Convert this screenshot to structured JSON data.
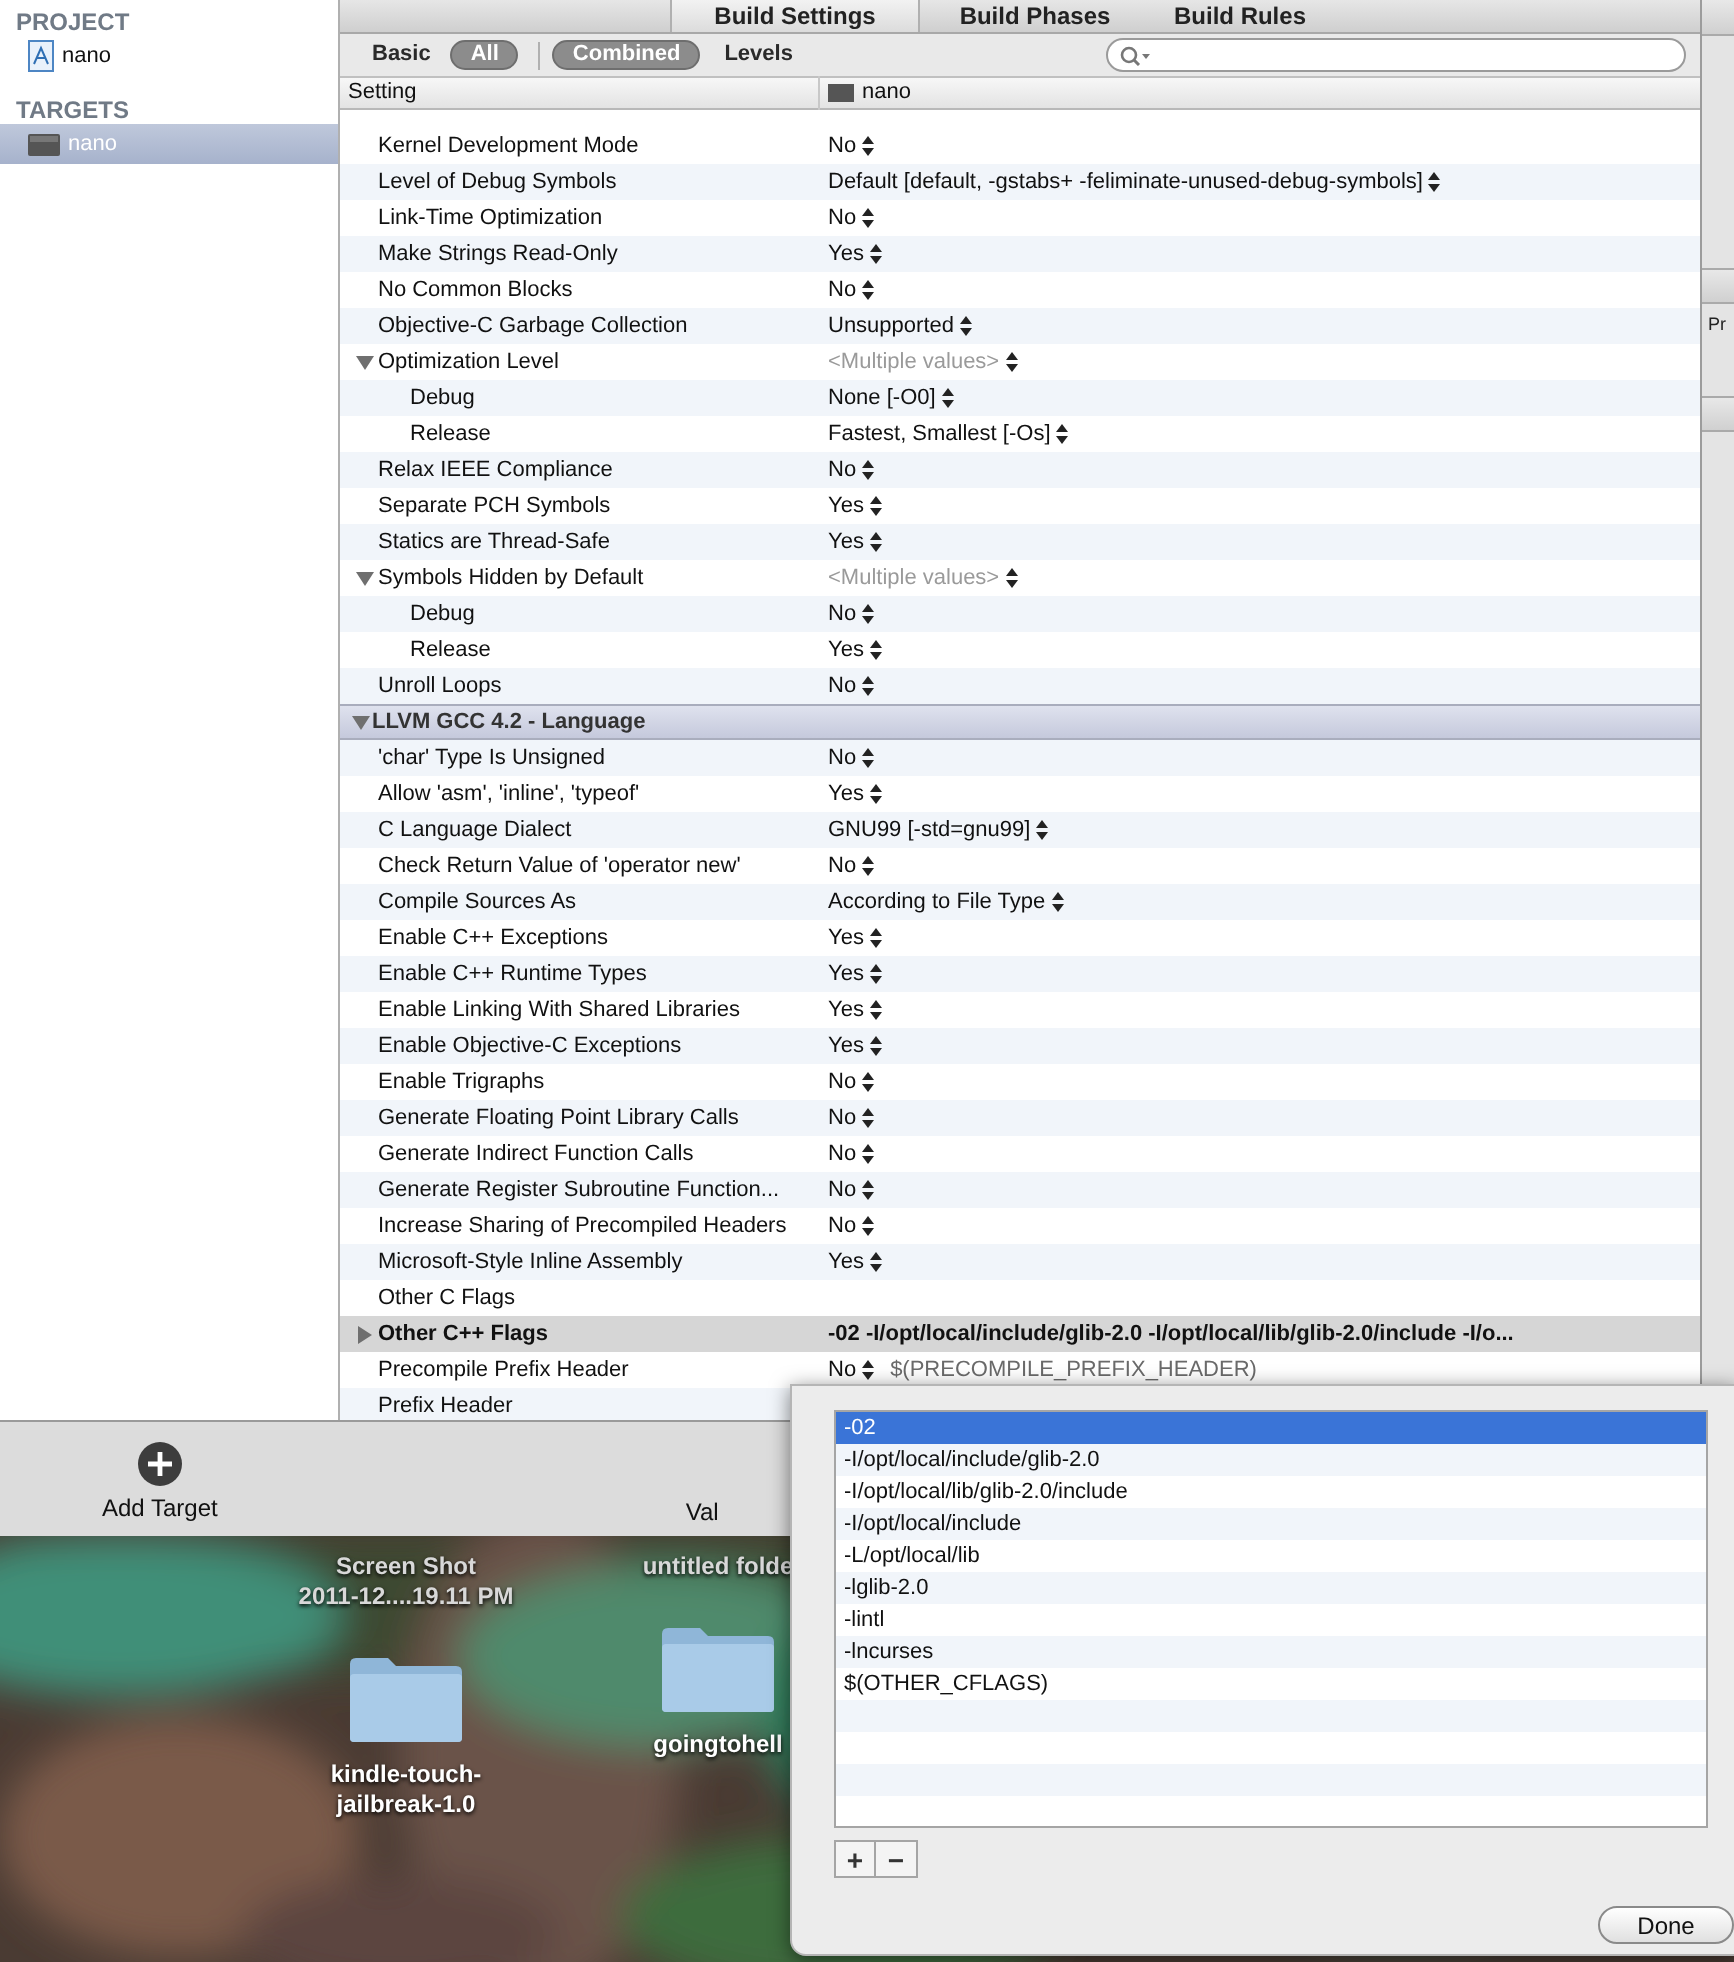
{
  "sidebar": {
    "sections": [
      {
        "title": "PROJECT",
        "items": [
          {
            "label": "nano",
            "kind": "project",
            "selected": false
          }
        ]
      },
      {
        "title": "TARGETS",
        "items": [
          {
            "label": "nano",
            "kind": "target",
            "selected": true
          }
        ]
      }
    ]
  },
  "tabs": [
    {
      "label": "Build Settings",
      "selected": true
    },
    {
      "label": "Build Phases",
      "selected": false
    },
    {
      "label": "Build Rules",
      "selected": false
    }
  ],
  "filters": {
    "scope": [
      {
        "label": "Basic",
        "selected": false
      },
      {
        "label": "All",
        "selected": true
      }
    ],
    "view": [
      {
        "label": "Combined",
        "selected": true
      },
      {
        "label": "Levels",
        "selected": false
      }
    ]
  },
  "table": {
    "columns": [
      "Setting",
      "nano"
    ],
    "sections": [
      {
        "rows": [
          {
            "name": "Kernel Development Mode",
            "value": "No",
            "popup": true,
            "selected": false,
            "customized": false
          },
          {
            "name": "Level of Debug Symbols",
            "value": "Default [default, -gstabs+ -feliminate-unused-debug-symbols]",
            "popup": true,
            "selected": false,
            "customized": false
          },
          {
            "name": "Link-Time Optimization",
            "value": "No",
            "popup": true,
            "selected": false,
            "customized": false
          },
          {
            "name": "Make Strings Read-Only",
            "value": "Yes",
            "popup": true,
            "selected": false,
            "customized": false
          },
          {
            "name": "No Common Blocks",
            "value": "No",
            "popup": true,
            "selected": false,
            "customized": false
          },
          {
            "name": "Objective-C Garbage Collection",
            "value": "Unsupported",
            "popup": true,
            "selected": false,
            "customized": false
          },
          {
            "name": "Optimization Level",
            "value": "<Multiple values>",
            "popup": true,
            "selected": false,
            "customized": false,
            "expanded": true,
            "children": [
              {
                "name": "Debug",
                "value": "None [-O0]",
                "popup": true,
                "selected": false,
                "customized": false
              },
              {
                "name": "Release",
                "value": "Fastest, Smallest [-Os]",
                "popup": true,
                "selected": false,
                "customized": false
              }
            ]
          },
          {
            "name": "Relax IEEE Compliance",
            "value": "No",
            "popup": true,
            "selected": false,
            "customized": false
          },
          {
            "name": "Separate PCH Symbols",
            "value": "Yes",
            "popup": true,
            "selected": false,
            "customized": false
          },
          {
            "name": "Statics are Thread-Safe",
            "value": "Yes",
            "popup": true,
            "selected": false,
            "customized": false
          },
          {
            "name": "Symbols Hidden by Default",
            "value": "<Multiple values>",
            "popup": true,
            "selected": false,
            "customized": false,
            "expanded": true,
            "children": [
              {
                "name": "Debug",
                "value": "No",
                "popup": true,
                "selected": false,
                "customized": false
              },
              {
                "name": "Release",
                "value": "Yes",
                "popup": true,
                "selected": false,
                "customized": false
              }
            ]
          },
          {
            "name": "Unroll Loops",
            "value": "No",
            "popup": true,
            "selected": false,
            "customized": false
          }
        ]
      },
      {
        "title": "LLVM GCC 4.2 - Language",
        "expanded": true,
        "rows": [
          {
            "name": "'char' Type Is Unsigned",
            "value": "No",
            "popup": true,
            "selected": false,
            "customized": false
          },
          {
            "name": "Allow 'asm', 'inline', 'typeof'",
            "value": "Yes",
            "popup": true,
            "selected": false,
            "customized": false
          },
          {
            "name": "C Language Dialect",
            "value": "GNU99 [-std=gnu99]",
            "popup": true,
            "selected": false,
            "customized": false
          },
          {
            "name": "Check Return Value of 'operator new'",
            "value": "No",
            "popup": true,
            "selected": false,
            "customized": false
          },
          {
            "name": "Compile Sources As",
            "value": "According to File Type",
            "popup": true,
            "selected": false,
            "customized": false
          },
          {
            "name": "Enable C++ Exceptions",
            "value": "Yes",
            "popup": true,
            "selected": false,
            "customized": false
          },
          {
            "name": "Enable C++ Runtime Types",
            "value": "Yes",
            "popup": true,
            "selected": false,
            "customized": false
          },
          {
            "name": "Enable Linking With Shared Libraries",
            "value": "Yes",
            "popup": true,
            "selected": false,
            "customized": false
          },
          {
            "name": "Enable Objective-C Exceptions",
            "value": "Yes",
            "popup": true,
            "selected": false,
            "customized": false
          },
          {
            "name": "Enable Trigraphs",
            "value": "No",
            "popup": true,
            "selected": false,
            "customized": false
          },
          {
            "name": "Generate Floating Point Library Calls",
            "value": "No",
            "popup": true,
            "selected": false,
            "customized": false
          },
          {
            "name": "Generate Indirect Function Calls",
            "value": "No",
            "popup": true,
            "selected": false,
            "customized": false
          },
          {
            "name": "Generate Register Subroutine Function...",
            "value": "No",
            "popup": true,
            "selected": false,
            "customized": false
          },
          {
            "name": "Increase Sharing of Precompiled Headers",
            "value": "No",
            "popup": true,
            "selected": false,
            "customized": false
          },
          {
            "name": "Microsoft-Style Inline Assembly",
            "value": "Yes",
            "popup": true,
            "selected": false,
            "customized": false
          },
          {
            "name": "Other C Flags",
            "popup": false,
            "selected": false,
            "customized": false
          },
          {
            "name": "Other C++ Flags",
            "value": "-02 -I/opt/local/include/glib-2.0 -I/opt/local/lib/glib-2.0/include -I/o...",
            "popup": false,
            "selected": true,
            "customized": true,
            "expanded": false
          },
          {
            "name": "Precompile Prefix Header",
            "value": "No",
            "note": "$(PRECOMPILE_PREFIX_HEADER)",
            "popup": true,
            "selected": false,
            "customized": false
          },
          {
            "name": "Prefix Header",
            "popup": false,
            "selected": false,
            "customized": false
          }
        ]
      }
    ]
  },
  "inspector": {
    "label": "Pr"
  },
  "bottom_bar": {
    "add_label": "Add Target",
    "cut_label": "Val"
  },
  "desktop": {
    "items": [
      {
        "kind": "caption",
        "lines": [
          "Screen Shot",
          "2011-12....19.11 PM"
        ]
      },
      {
        "kind": "folder",
        "lines": [
          "kindle-touch-",
          "jailbreak-1.0"
        ]
      },
      {
        "kind": "caption",
        "lines": [
          "untitled folde"
        ]
      },
      {
        "kind": "folder",
        "lines": [
          "goingtohell"
        ]
      }
    ]
  },
  "popover": {
    "items": [
      {
        "label": "-02",
        "selected": true
      },
      {
        "label": "-I/opt/local/include/glib-2.0",
        "selected": false
      },
      {
        "label": "-I/opt/local/lib/glib-2.0/include",
        "selected": false
      },
      {
        "label": "-I/opt/local/include",
        "selected": false
      },
      {
        "label": "-L/opt/local/lib",
        "selected": false
      },
      {
        "label": "-lglib-2.0",
        "selected": false
      },
      {
        "label": "-lintl",
        "selected": false
      },
      {
        "label": "-lncurses",
        "selected": false
      },
      {
        "label": "$(OTHER_CFLAGS)",
        "selected": false
      }
    ],
    "add_label": "+",
    "remove_label": "−",
    "done_label": "Done"
  }
}
